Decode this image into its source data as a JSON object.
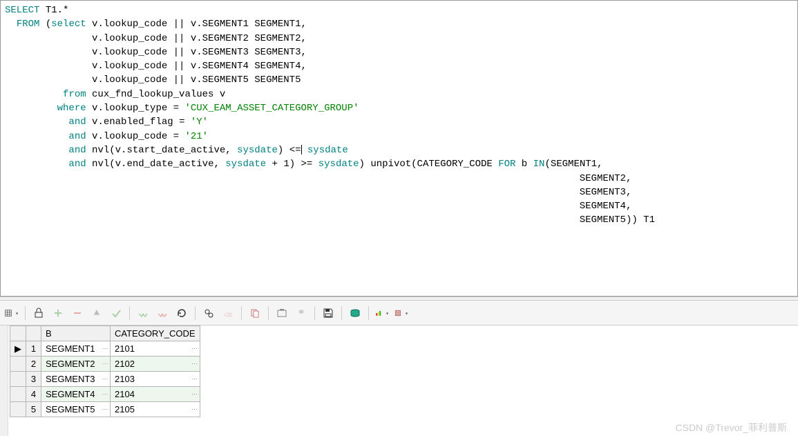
{
  "sql": {
    "lines": [
      [
        {
          "cls": "kw",
          "t": "SELECT"
        },
        {
          "cls": "op",
          "t": " T1"
        },
        {
          "cls": "op",
          "t": ".*"
        }
      ],
      [
        {
          "cls": "sp",
          "t": "  "
        },
        {
          "cls": "kw",
          "t": "FROM"
        },
        {
          "cls": "op",
          "t": " ("
        },
        {
          "cls": "kw",
          "t": "select"
        },
        {
          "cls": "op",
          "t": " v.lookup_code || v.SEGMENT1 SEGMENT1,"
        }
      ],
      [
        {
          "cls": "sp",
          "t": "               "
        },
        {
          "cls": "op",
          "t": "v.lookup_code || v.SEGMENT2 SEGMENT2,"
        }
      ],
      [
        {
          "cls": "sp",
          "t": "               "
        },
        {
          "cls": "op",
          "t": "v.lookup_code || v.SEGMENT3 SEGMENT3,"
        }
      ],
      [
        {
          "cls": "sp",
          "t": "               "
        },
        {
          "cls": "op",
          "t": "v.lookup_code || v.SEGMENT4 SEGMENT4,"
        }
      ],
      [
        {
          "cls": "sp",
          "t": "               "
        },
        {
          "cls": "op",
          "t": "v.lookup_code || v.SEGMENT5 SEGMENT5"
        }
      ],
      [
        {
          "cls": "sp",
          "t": "          "
        },
        {
          "cls": "kw",
          "t": "from"
        },
        {
          "cls": "op",
          "t": " cux_fnd_lookup_values v"
        }
      ],
      [
        {
          "cls": "sp",
          "t": "         "
        },
        {
          "cls": "kw",
          "t": "where"
        },
        {
          "cls": "op",
          "t": " v.lookup_type = "
        },
        {
          "cls": "str",
          "t": "'CUX_EAM_ASSET_CATEGORY_GROUP'"
        }
      ],
      [
        {
          "cls": "sp",
          "t": "           "
        },
        {
          "cls": "kw",
          "t": "and"
        },
        {
          "cls": "op",
          "t": " v.enabled_flag = "
        },
        {
          "cls": "str",
          "t": "'Y'"
        }
      ],
      [
        {
          "cls": "sp",
          "t": "           "
        },
        {
          "cls": "kw",
          "t": "and"
        },
        {
          "cls": "op",
          "t": " v.lookup_code = "
        },
        {
          "cls": "str",
          "t": "'21'"
        }
      ],
      [
        {
          "cls": "sp",
          "t": "           "
        },
        {
          "cls": "kw",
          "t": "and"
        },
        {
          "cls": "op",
          "t": " nvl(v.start_date_active, "
        },
        {
          "cls": "kw",
          "t": "sysdate"
        },
        {
          "cls": "op",
          "t": ") <="
        },
        {
          "cls": "cursor",
          "t": ""
        },
        {
          "cls": "op",
          "t": " "
        },
        {
          "cls": "kw",
          "t": "sysdate"
        }
      ],
      [
        {
          "cls": "sp",
          "t": "           "
        },
        {
          "cls": "kw",
          "t": "and"
        },
        {
          "cls": "op",
          "t": " nvl(v.end_date_active, "
        },
        {
          "cls": "kw",
          "t": "sysdate"
        },
        {
          "cls": "op",
          "t": " + "
        },
        {
          "cls": "num",
          "t": "1"
        },
        {
          "cls": "op",
          "t": ") >= "
        },
        {
          "cls": "kw",
          "t": "sysdate"
        },
        {
          "cls": "op",
          "t": ") unpivot(CATEGORY_CODE "
        },
        {
          "cls": "kw",
          "t": "FOR"
        },
        {
          "cls": "op",
          "t": " b "
        },
        {
          "cls": "kw",
          "t": "IN"
        },
        {
          "cls": "op",
          "t": "(SEGMENT1,"
        }
      ],
      [
        {
          "cls": "sp",
          "t": "                                                                                                   "
        },
        {
          "cls": "op",
          "t": "SEGMENT2,"
        }
      ],
      [
        {
          "cls": "sp",
          "t": "                                                                                                   "
        },
        {
          "cls": "op",
          "t": "SEGMENT3,"
        }
      ],
      [
        {
          "cls": "sp",
          "t": "                                                                                                   "
        },
        {
          "cls": "op",
          "t": "SEGMENT4,"
        }
      ],
      [
        {
          "cls": "sp",
          "t": "                                                                                                   "
        },
        {
          "cls": "op",
          "t": "SEGMENT5)) T1"
        }
      ]
    ]
  },
  "grid": {
    "columns": [
      "",
      "",
      "B",
      "CATEGORY_CODE"
    ],
    "rows": [
      {
        "ptr": "▶",
        "n": "1",
        "b": "SEGMENT1",
        "code": "2101"
      },
      {
        "ptr": "",
        "n": "2",
        "b": "SEGMENT2",
        "code": "2102"
      },
      {
        "ptr": "",
        "n": "3",
        "b": "SEGMENT3",
        "code": "2103"
      },
      {
        "ptr": "",
        "n": "4",
        "b": "SEGMENT4",
        "code": "2104"
      },
      {
        "ptr": "",
        "n": "5",
        "b": "SEGMENT5",
        "code": "2105"
      }
    ]
  },
  "watermark": "CSDN @Trevor_菲利普斯"
}
